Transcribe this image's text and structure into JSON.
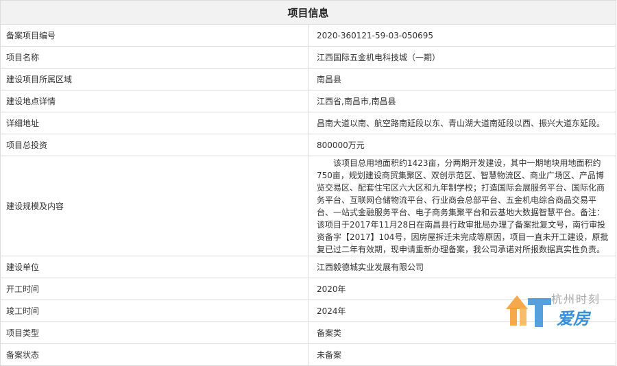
{
  "title": "项目信息",
  "rows": [
    {
      "label": "备案项目编号",
      "value": "2020-360121-59-03-050695"
    },
    {
      "label": "项目名称",
      "value": "江西国际五金机电科技城（一期）"
    },
    {
      "label": "建设项目所属区域",
      "value": "南昌县"
    },
    {
      "label": "建设地点详情",
      "value": "江西省,南昌市,南昌县"
    },
    {
      "label": "详细地址",
      "value": "昌南大道以南、航空路南延段以东、青山湖大道南延段以西、振兴大道东延段。"
    },
    {
      "label": "项目总投资",
      "value": "800000万元"
    },
    {
      "label": "建设规模及内容",
      "value": "该项目总用地面积约1423亩，分两期开发建设，其中一期地块用地面积约750亩，规划建设商贸集聚区、双创示范区、智慧物流区、商业广场区、产品博览交易区、配套住宅区六大区和九年制学校；打造国际会展服务平台、国际化商务平台、互联网仓储物流平台、行业商会总部平台、五金机电综合商品交易平台、一站式金融服务平台、电子商务集聚平台和云基地大数据智慧平台。备注：该项目于2017年11月28日在南昌县行政审批局办理了备案批复文号，南行审投资备字【2017】104号，因房屋拆迁未完成等原因，项目一直未开工建设，原批复已过二年有效期，现申请重新办理备案，我公司承诺对所报数据真实性负责。"
    },
    {
      "label": "建设单位",
      "value": "江西毅德城实业发展有限公司"
    },
    {
      "label": "开工时间",
      "value": "2020年"
    },
    {
      "label": "竣工时间",
      "value": "2024年"
    },
    {
      "label": "项目类型",
      "value": "备案类"
    },
    {
      "label": "备案状态",
      "value": "未备案"
    }
  ],
  "watermark": {
    "text": "杭州时刻",
    "brand": "爱房"
  },
  "colors": {
    "header_bg": "#f2f2f2",
    "border": "#dcdcdc",
    "text": "#333333",
    "brand": "#3a8fd8",
    "logo_orange": "#f39a2b"
  }
}
